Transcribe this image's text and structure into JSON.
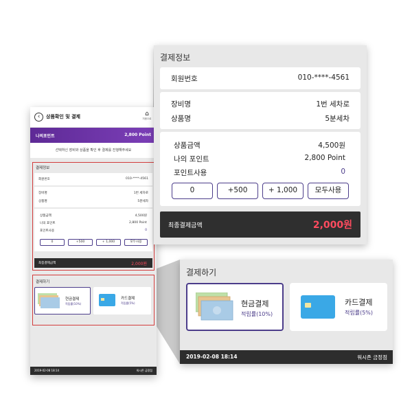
{
  "phone": {
    "header_title": "상품확인 및 결제",
    "home_label": "처음으로",
    "points_label": "나의포인트",
    "points_value": "2,800 Point",
    "notice": "선택하신 장비와 상품을 확인 후 결제를 진행해주세요",
    "footer_datetime": "2019-02-08 18:14",
    "footer_store": "워시존 금정점"
  },
  "payment_info": {
    "title": "결제정보",
    "member_label": "회원번호",
    "member_value": "010-****-4561",
    "equipment_label": "장비명",
    "equipment_value": "1번 세차로",
    "product_label": "상품명",
    "product_value": "5분세차",
    "amount_label": "상품금액",
    "amount_value": "4,500원",
    "my_points_label": "나의 포인트",
    "my_points_value": "2,800 Point",
    "point_use_label": "포인트사용",
    "point_use_value": "0",
    "buttons": [
      "0",
      "+500",
      "+ 1,000",
      "모두사용"
    ],
    "total_label": "최종결제금액",
    "total_value": "2,000원"
  },
  "pay": {
    "title": "결제하기",
    "cash_name": "현금결제",
    "cash_rate": "적립률(10%)",
    "card_name": "카드결제",
    "card_rate": "적립률(5%)",
    "footer_datetime": "2019-02-08 18:14",
    "footer_store": "워시존 금정점"
  },
  "colors": {
    "accent": "#4b3c8a",
    "points_bar": "#6a32a8",
    "total_red": "#ff4b5f",
    "highlight_border": "#d33b3b"
  },
  "icons": [
    "back-arrow-icon",
    "home-icon",
    "cash-bills-icon",
    "credit-card-icon"
  ]
}
